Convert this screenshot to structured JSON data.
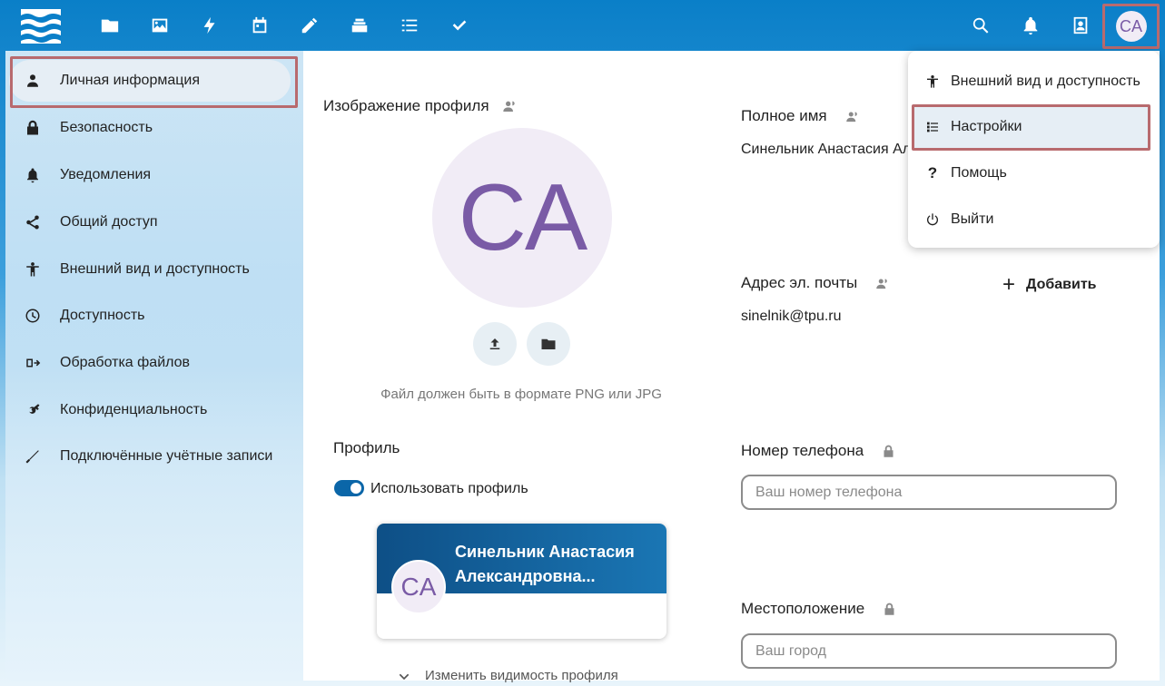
{
  "header": {
    "apps": [
      {
        "icon": "folder-icon",
        "name": "files"
      },
      {
        "icon": "image-icon",
        "name": "photos"
      },
      {
        "icon": "lightning-icon",
        "name": "activity"
      },
      {
        "icon": "calendar-icon",
        "name": "calendar"
      },
      {
        "icon": "pencil-icon",
        "name": "notes"
      },
      {
        "icon": "stack-icon",
        "name": "deck"
      },
      {
        "icon": "list-icon",
        "name": "tasks"
      },
      {
        "icon": "checkmark-icon",
        "name": "checklist"
      }
    ],
    "avatar_initials": "CA"
  },
  "sidebar": {
    "items": [
      {
        "label": "Личная информация",
        "icon": "user-icon"
      },
      {
        "label": "Безопасность",
        "icon": "lock-icon"
      },
      {
        "label": "Уведомления",
        "icon": "bell-icon"
      },
      {
        "label": "Общий доступ",
        "icon": "share-icon"
      },
      {
        "label": "Внешний вид и доступность",
        "icon": "accessibility-icon"
      },
      {
        "label": "Доступность",
        "icon": "clock-icon"
      },
      {
        "label": "Обработка файлов",
        "icon": "file-flow-icon"
      },
      {
        "label": "Конфиденциальность",
        "icon": "key-icon"
      },
      {
        "label": "Подключённые учётные записи",
        "icon": "wrench-icon"
      }
    ]
  },
  "profile_picture": {
    "title": "Изображение профиля",
    "initials": "CA",
    "hint": "Файл должен быть в формате PNG или JPG"
  },
  "profile": {
    "title": "Профиль",
    "toggle_label": "Использовать профиль",
    "card_name": "Синельник Анастасия Александровна...",
    "card_initials": "CA",
    "visibility_link": "Изменить видимость профиля"
  },
  "fields": {
    "full_name_label": "Полное имя",
    "full_name_value": "Синельник Анастасия Ал",
    "email_label": "Адрес эл. почты",
    "email_value": "sinelnik@tpu.ru",
    "add_label": "Добавить",
    "phone_label": "Номер телефона",
    "phone_placeholder": "Ваш номер телефона",
    "location_label": "Местоположение",
    "location_placeholder": "Ваш город"
  },
  "menu": {
    "items": [
      {
        "label": "Внешний вид и доступность",
        "icon": "accessibility-icon"
      },
      {
        "label": "Настройки",
        "icon": "settings-list-icon"
      },
      {
        "label": "Помощь",
        "icon": "question-icon"
      },
      {
        "label": "Выйти",
        "icon": "power-icon"
      }
    ]
  }
}
